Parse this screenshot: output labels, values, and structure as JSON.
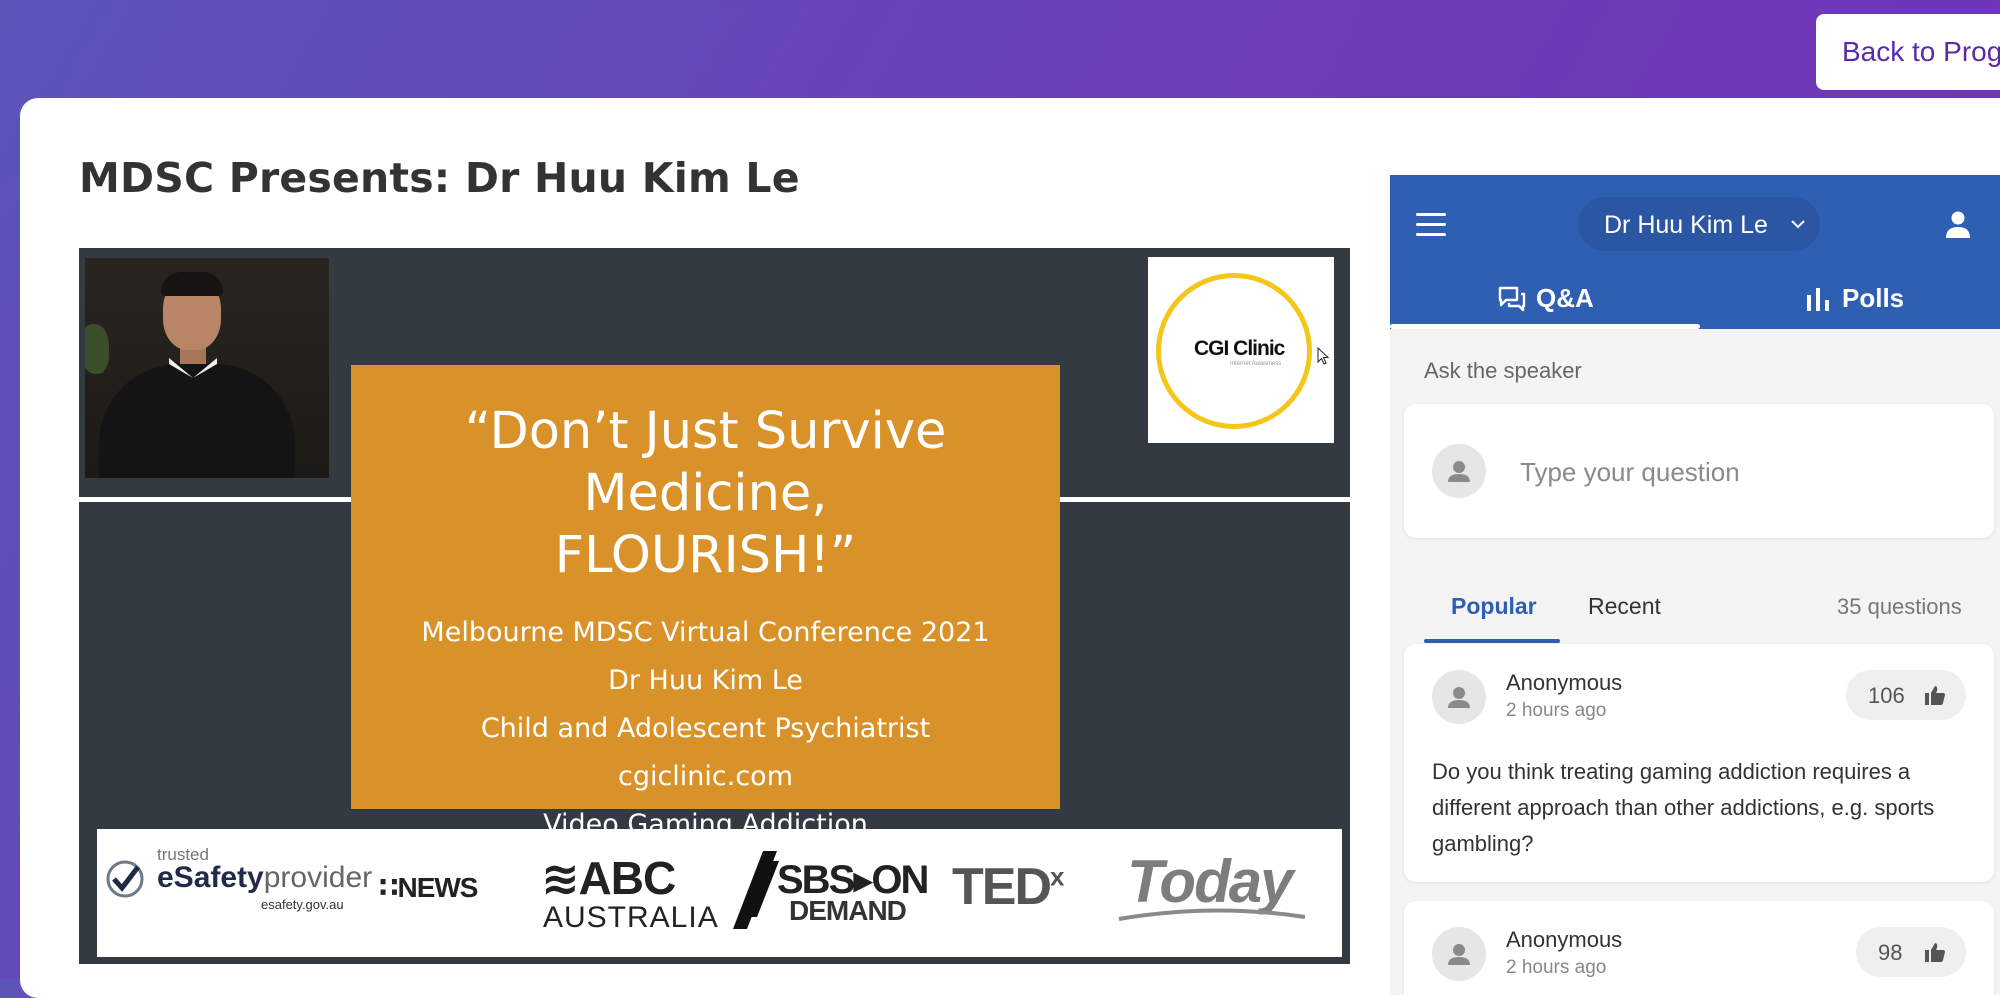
{
  "header": {
    "back_button_label": "Back to Progr"
  },
  "page": {
    "title": "MDSC Presents: Dr Huu Kim Le"
  },
  "video": {
    "logo": {
      "name": "CGI Clinic",
      "tagline": "Internet Awareness"
    },
    "slide": {
      "title_line1": "“Don’t Just Survive Medicine,",
      "title_line2": "FLOURISH!”",
      "lines": [
        "Melbourne MDSC Virtual Conference 2021",
        "Dr Huu Kim Le",
        "Child and Adolescent Psychiatrist",
        "cgiclinic.com",
        "Video Gaming Addiction"
      ]
    },
    "media_logos": {
      "esafety_trusted": "trusted",
      "esafety_main": "eSafety",
      "esafety_provider": "provider",
      "esafety_domain": "esafety.gov.au",
      "nine_news": "∷NEWS",
      "abc_main": "≋ABC",
      "abc_sub": "AUSTRALIA",
      "sbs_main": "SBS▸ON",
      "sbs_sub": "DEMAND",
      "tedx": "TED",
      "tedx_sup": "x",
      "today": "Today"
    }
  },
  "panel": {
    "session_name": "Dr Huu Kim Le",
    "tabs": {
      "qa": "Q&A",
      "polls": "Polls"
    },
    "ask_label": "Ask the speaker",
    "question_placeholder": "Type your question",
    "filters": {
      "popular": "Popular",
      "recent": "Recent"
    },
    "question_count": "35 questions",
    "questions": [
      {
        "author": "Anonymous",
        "time": "2 hours ago",
        "votes": "106",
        "text": "Do you think treating gaming addiction requires a different approach than other addictions, e.g. sports gambling?"
      },
      {
        "author": "Anonymous",
        "time": "2 hours ago",
        "votes": "98",
        "text": ""
      }
    ]
  },
  "colors": {
    "brand_purple": "#6a3fb8",
    "panel_blue": "#2f5fb3",
    "slide_orange": "#d9922a",
    "slide_background": "#333a42",
    "logo_yellow": "#f3c619"
  },
  "icons": [
    "menu-icon",
    "chevron-down-icon",
    "user-icon",
    "chat-icon",
    "bar-chart-icon",
    "avatar-icon",
    "thumbs-up-icon",
    "cursor-icon",
    "checkmark-icon"
  ]
}
